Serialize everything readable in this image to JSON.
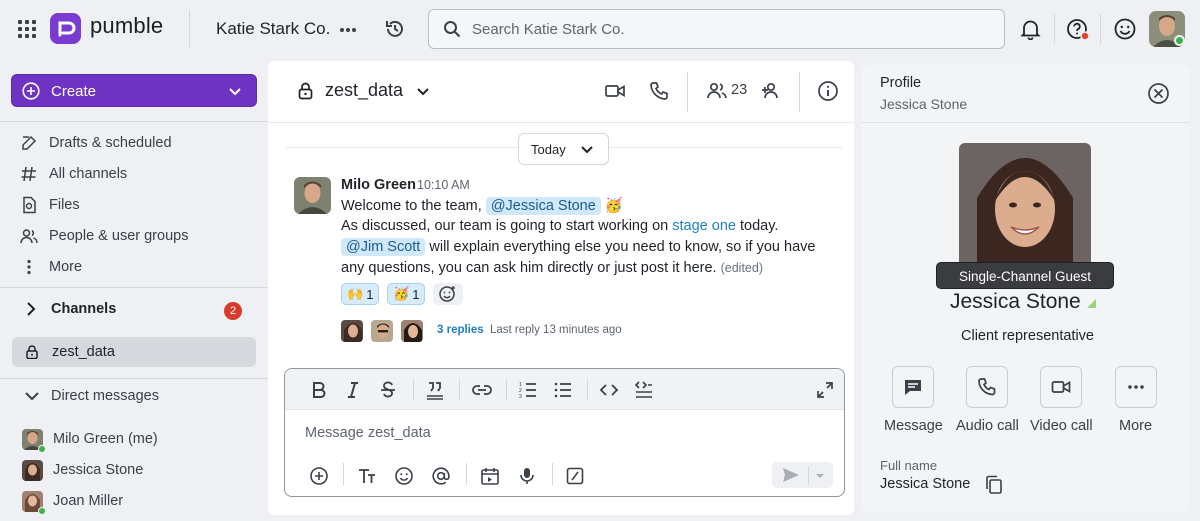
{
  "app": {
    "logo_text": "pumble",
    "workspace": "Katie Stark Co."
  },
  "search": {
    "placeholder": "Search Katie Stark Co."
  },
  "sidebar": {
    "create_label": "Create",
    "items": [
      {
        "label": "Drafts & scheduled",
        "icon": "pencil-icon"
      },
      {
        "label": "All channels",
        "icon": "hash-icon"
      },
      {
        "label": "Files",
        "icon": "file-icon"
      },
      {
        "label": "People & user groups",
        "icon": "people-icon"
      },
      {
        "label": "More",
        "icon": "more-vertical-icon"
      }
    ],
    "channels_label": "Channels",
    "channels_badge": "2",
    "active_channel": "zest_data",
    "dm_label": "Direct messages",
    "dms": [
      {
        "label": "Milo Green (me)"
      },
      {
        "label": "Jessica Stone"
      },
      {
        "label": "Joan Miller"
      }
    ]
  },
  "channel": {
    "name": "zest_data",
    "member_count": "23"
  },
  "messages": {
    "day_divider": "Today",
    "author": "Milo Green",
    "time": "10:10 AM",
    "line1_prefix": "Welcome to the team,",
    "mention1": "@Jessica Stone",
    "emoji1": "🥳",
    "line2_prefix": "As discussed, our team is going to start working on",
    "line2_link": "stage one",
    "line2_suffix": "today.",
    "mention2": "@Jim Scott",
    "line3_suffix": "will explain everything else you need to know, so if you have",
    "line4": "any questions, you can ask him directly or just post it here.",
    "edited": "(edited)",
    "reactions": [
      {
        "emoji": "🙌",
        "count": "1"
      },
      {
        "emoji": "🥳",
        "count": "1"
      }
    ],
    "replies": "3 replies",
    "last_reply": "Last reply 13 minutes ago"
  },
  "composer": {
    "placeholder": "Message zest_data"
  },
  "profile": {
    "title": "Profile",
    "subtitle": "Jessica Stone",
    "guest_tag": "Single-Channel Guest",
    "name": "Jessica Stone",
    "role": "Client representative",
    "actions": [
      {
        "label": "Message"
      },
      {
        "label": "Audio call"
      },
      {
        "label": "Video call"
      },
      {
        "label": "More"
      }
    ],
    "full_name_label": "Full name",
    "full_name_value": "Jessica Stone"
  },
  "colors": {
    "brand": "#6f33c4",
    "mention_bg": "#cfe8fb",
    "link": "#1f7fc7",
    "badge": "#d93a2b",
    "online": "#41b04a"
  }
}
